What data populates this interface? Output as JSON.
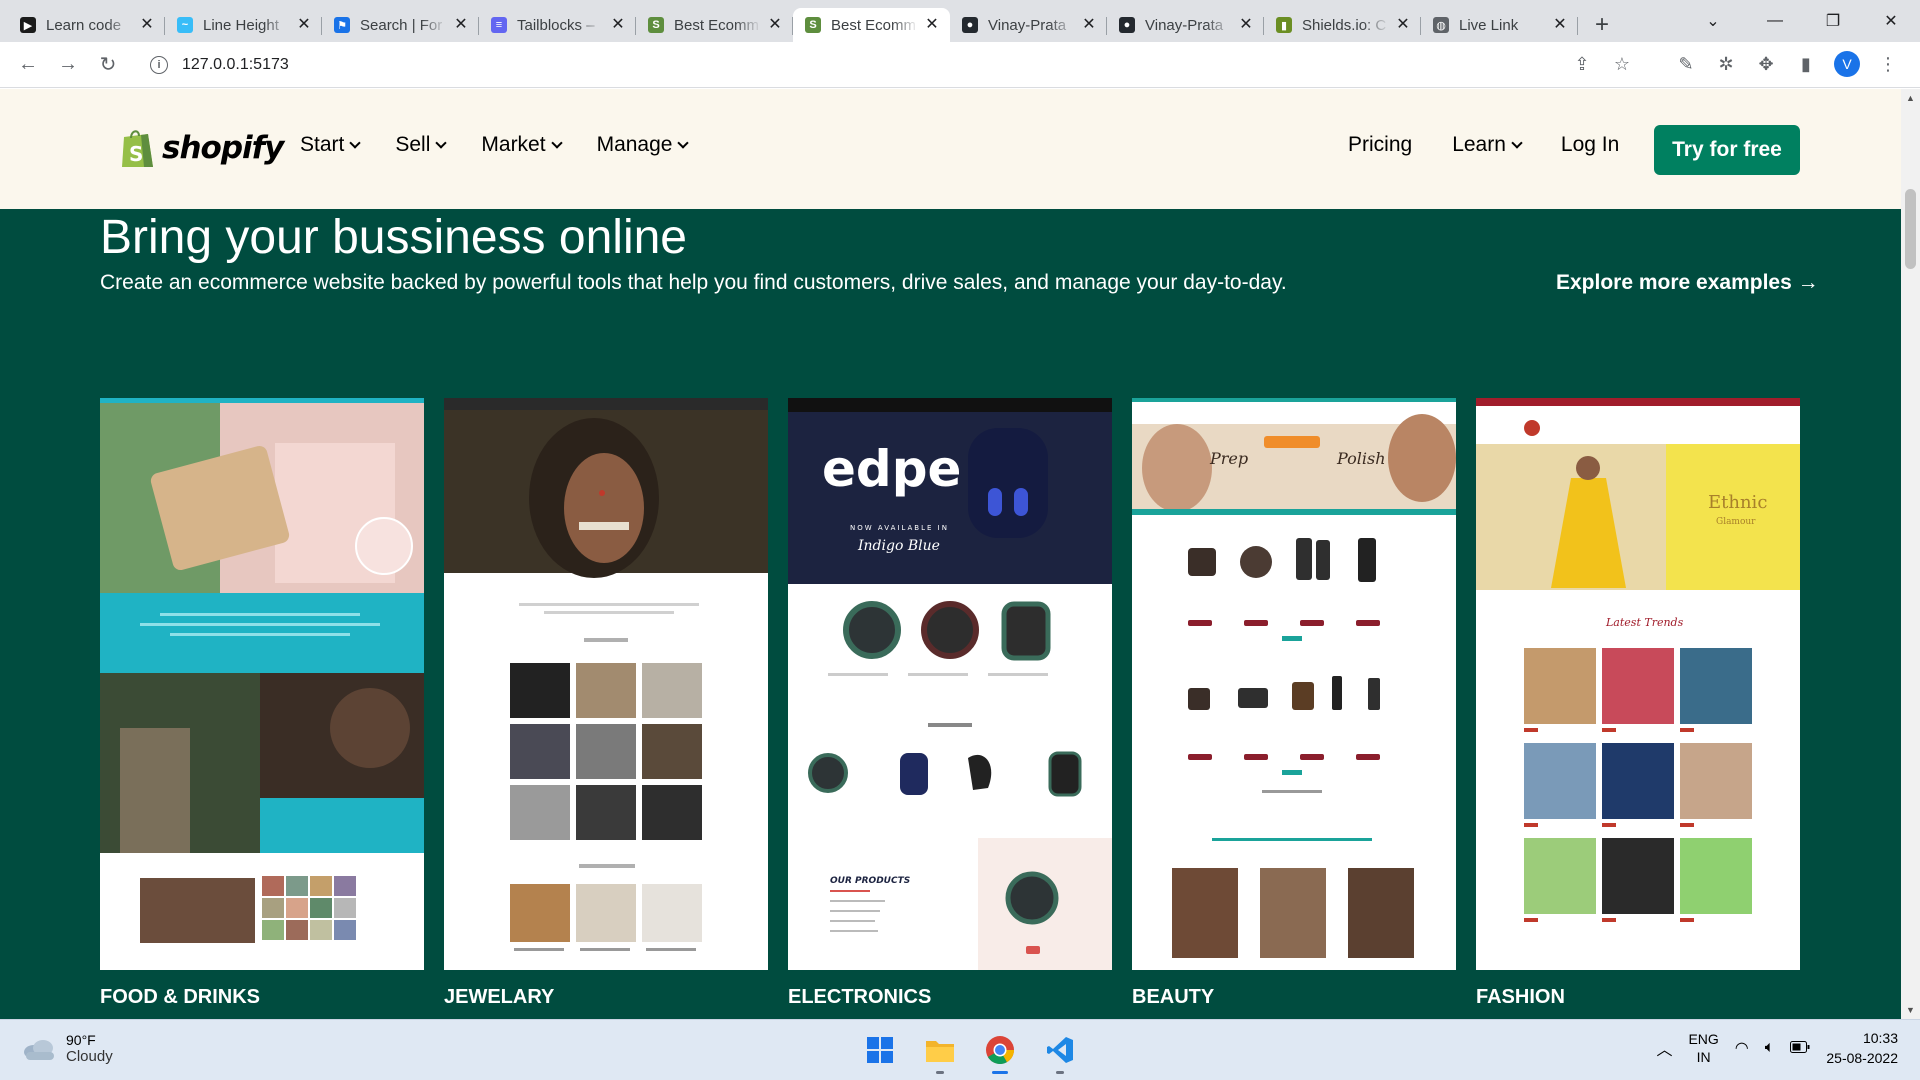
{
  "browser": {
    "tabs": [
      {
        "title": "Learn code",
        "favicon_color": "#1b1b1b",
        "favicon_glyph": "▶"
      },
      {
        "title": "Line Height",
        "favicon_color": "#38bdf8",
        "favicon_glyph": "~"
      },
      {
        "title": "Search | For",
        "favicon_color": "#1a73e8",
        "favicon_glyph": "⚑"
      },
      {
        "title": "Tailblocks –",
        "favicon_color": "#6366f1",
        "favicon_glyph": "≡"
      },
      {
        "title": "Best Ecomm",
        "favicon_color": "#5e8e3e",
        "favicon_glyph": "S"
      },
      {
        "title": "Best Ecomm",
        "favicon_color": "#5e8e3e",
        "favicon_glyph": "S",
        "active": true
      },
      {
        "title": "Vinay-Prata",
        "favicon_color": "#24292f",
        "favicon_glyph": "●"
      },
      {
        "title": "Vinay-Prata",
        "favicon_color": "#24292f",
        "favicon_glyph": "●"
      },
      {
        "title": "Shields.io: C",
        "favicon_color": "#6b8e23",
        "favicon_glyph": "▮"
      },
      {
        "title": "Live Link",
        "favicon_color": "#5f6368",
        "favicon_glyph": "◍"
      }
    ],
    "url": "127.0.0.1:5173",
    "profile_initial": "V"
  },
  "site": {
    "logo_text": "shopify",
    "nav_left": [
      "Start",
      "Sell",
      "Market",
      "Manage"
    ],
    "nav_right": {
      "pricing": "Pricing",
      "learn": "Learn",
      "login": "Log In"
    },
    "cta": "Try for free",
    "headline": "Bring your bussiness online",
    "subheadline": "Create an ecommerce website backed by powerful tools that help you find customers, drive sales, and manage your day-to-day.",
    "explore": "Explore more examples →",
    "categories": [
      {
        "label": "FOOD & DRINKS",
        "accent": "#1fb3c4"
      },
      {
        "label": "JEWELARY",
        "accent": "#2a2a2a"
      },
      {
        "label": "ELECTRONICS",
        "accent": "#1c2340",
        "hero_text": "edpe",
        "hero_sub": "NOW AVAILABLE IN",
        "hero_script": "Indigo Blue",
        "section_label": "OUR PRODUCTS"
      },
      {
        "label": "BEAUTY",
        "accent": "#f08d2a",
        "hero_left": "Prep",
        "hero_right": "Polish"
      },
      {
        "label": "FASHION",
        "accent": "#f3e34d",
        "hero_text": "Ethnic",
        "hero_sub": "Glamour",
        "section_label": "Latest Trends"
      }
    ],
    "colors": {
      "header_bg": "#fbf7ed",
      "hero_bg": "#004c3f",
      "cta_bg": "#008060"
    }
  },
  "taskbar": {
    "temperature": "90°F",
    "condition": "Cloudy",
    "lang_primary": "ENG",
    "lang_secondary": "IN",
    "time": "10:33",
    "date": "25-08-2022"
  }
}
